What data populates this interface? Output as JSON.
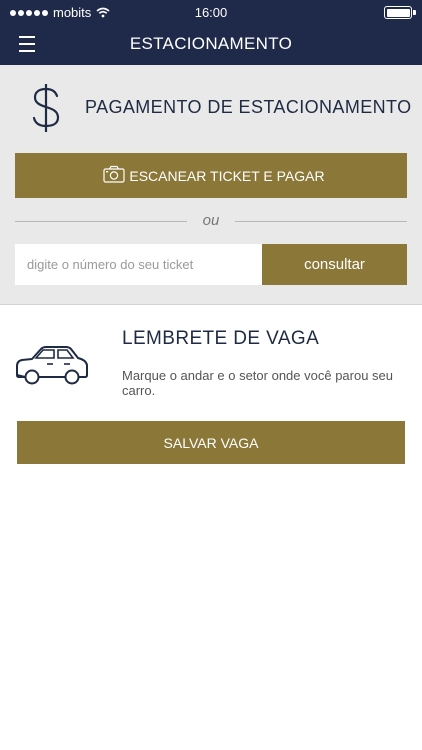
{
  "status_bar": {
    "carrier": "mobits",
    "time": "16:00"
  },
  "nav": {
    "title": "ESTACIONAMENTO"
  },
  "payment": {
    "title": "PAGAMENTO DE ESTACIONAMENTO",
    "scan_button": "ESCANEAR TICKET E PAGAR",
    "divider_text": "ou",
    "ticket_input": {
      "value": "",
      "placeholder": "digite o número do seu ticket"
    },
    "consult_button": "consultar"
  },
  "reminder": {
    "title": "LEMBRETE DE VAGA",
    "description": "Marque o andar e o setor onde você parou seu carro.",
    "save_button": "SALVAR VAGA"
  },
  "colors": {
    "nav_background": "#1f2a4a",
    "accent_gold": "#8b7738",
    "section_background": "#e9e9e9"
  },
  "icons": [
    "menu-icon",
    "wifi-icon",
    "battery-icon",
    "dollar-icon",
    "camera-icon",
    "car-icon"
  ]
}
